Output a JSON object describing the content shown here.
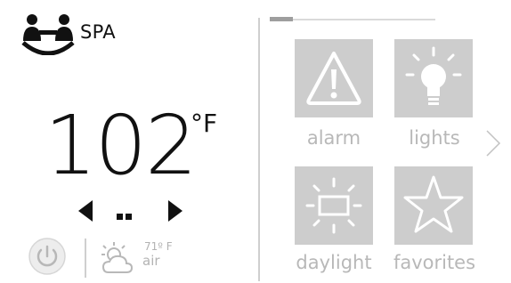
{
  "header": {
    "title": "SPA",
    "logo_icon": "spa-people-icon"
  },
  "temperature": {
    "value": "102",
    "unit": "°F"
  },
  "controls": {
    "decrease_icon": "triangle-left-icon",
    "increase_icon": "triangle-right-icon",
    "page_indicator_icon": "page-dots-icon",
    "power_icon": "power-icon"
  },
  "weather": {
    "icon": "partly-cloudy-icon",
    "temp": "71º F",
    "label": "air"
  },
  "tiles": [
    {
      "label": "alarm",
      "icon": "alarm-warning-icon"
    },
    {
      "label": "lights",
      "icon": "lightbulb-icon"
    },
    {
      "label": "daylight",
      "icon": "daylight-icon"
    },
    {
      "label": "favorites",
      "icon": "star-icon"
    }
  ],
  "navigation": {
    "next_icon": "chevron-right-icon"
  },
  "colors": {
    "tile_bg": "#cdcdcd",
    "tile_label": "#b8b8b8",
    "text": "#111111",
    "divider": "#cfcfcf"
  }
}
